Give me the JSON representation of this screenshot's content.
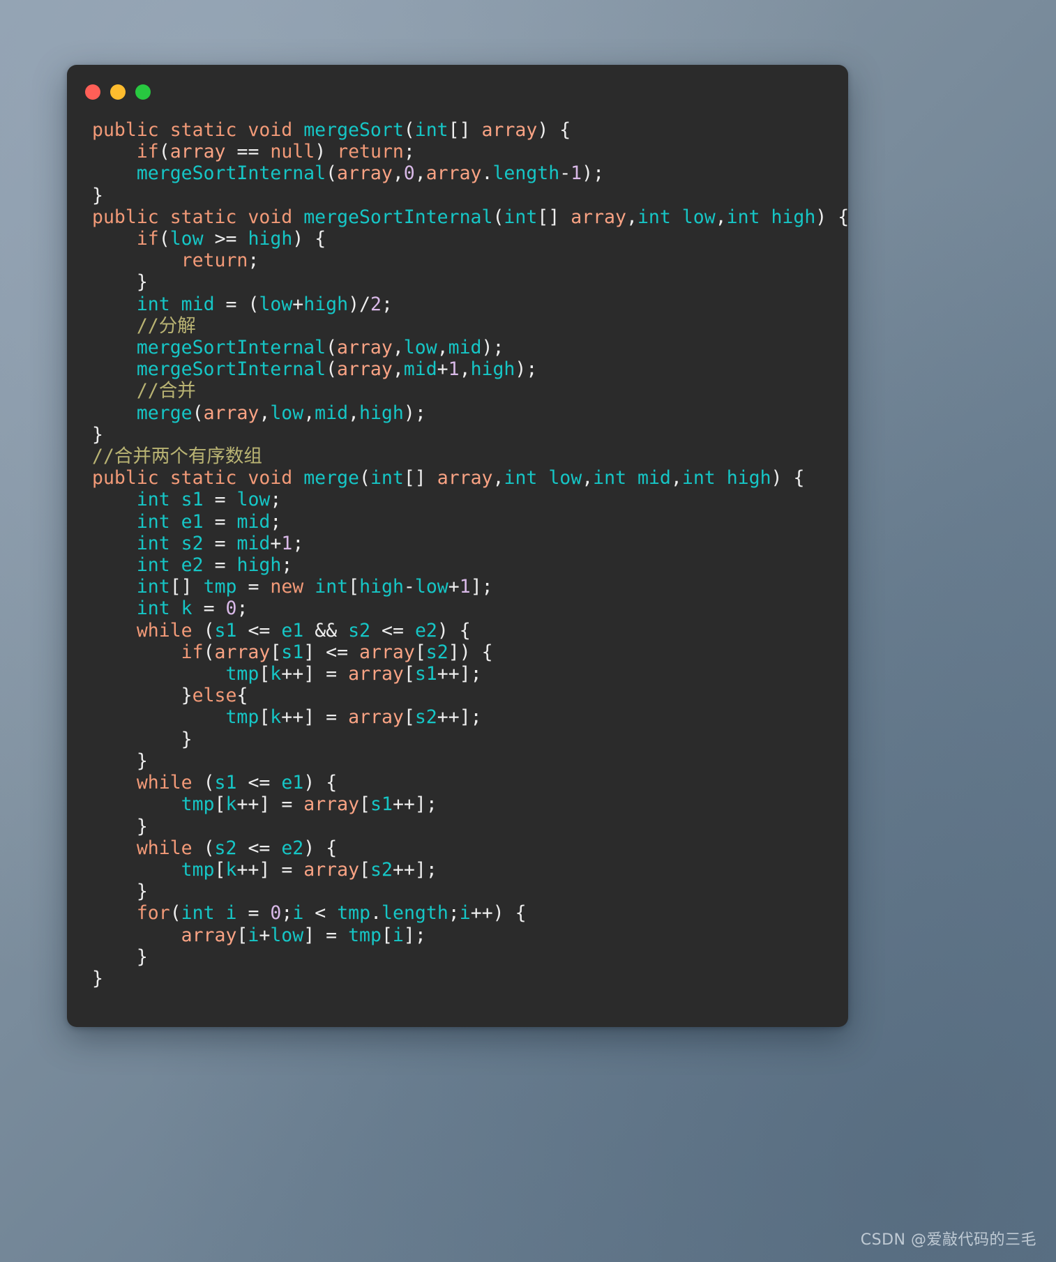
{
  "window": {
    "title": "",
    "traffic_lights": [
      {
        "name": "close",
        "color": "#ff5f57",
        "label": ""
      },
      {
        "name": "minimize",
        "color": "#febc2e",
        "label": ""
      },
      {
        "name": "zoom",
        "color": "#28c840",
        "label": ""
      }
    ]
  },
  "theme": {
    "background": "#2b2b2b",
    "desktop_gradient_from": "#8d9cae",
    "desktop_gradient_to": "#63788c",
    "keyword": "#f29a78",
    "type": "#16c6c6",
    "identifier": "#f9a384",
    "number": "#d9b9e8",
    "comment": "#b9b373",
    "punctuation": "#eeeeee",
    "language": "Java"
  },
  "code": {
    "lines": [
      "public static void mergeSort(int[] array) {",
      "    if(array == null) return;",
      "    mergeSortInternal(array,0,array.length-1);",
      "}",
      "public static void mergeSortInternal(int[] array,int low,int high) {",
      "    if(low >= high) {",
      "        return;",
      "    }",
      "    int mid = (low+high)/2;",
      "    //分解",
      "    mergeSortInternal(array,low,mid);",
      "    mergeSortInternal(array,mid+1,high);",
      "    //合并",
      "    merge(array,low,mid,high);",
      "}",
      "//合并两个有序数组",
      "public static void merge(int[] array,int low,int mid,int high) {",
      "    int s1 = low;",
      "    int e1 = mid;",
      "    int s2 = mid+1;",
      "    int e2 = high;",
      "    int[] tmp = new int[high-low+1];",
      "    int k = 0;",
      "    while (s1 <= e1 && s2 <= e2) {",
      "        if(array[s1] <= array[s2]) {",
      "            tmp[k++] = array[s1++];",
      "        }else{",
      "            tmp[k++] = array[s2++];",
      "        }",
      "    }",
      "    while (s1 <= e1) {",
      "        tmp[k++] = array[s1++];",
      "    }",
      "    while (s2 <= e2) {",
      "        tmp[k++] = array[s2++];",
      "    }",
      "    for(int i = 0;i < tmp.length;i++) {",
      "        array[i+low] = tmp[i];",
      "    }",
      "}"
    ],
    "comments": [
      "//分解",
      "//合并",
      "//合并两个有序数组"
    ],
    "methods": [
      "mergeSort",
      "mergeSortInternal",
      "merge"
    ]
  },
  "watermark": {
    "text": "CSDN @爱敲代码的三毛"
  }
}
